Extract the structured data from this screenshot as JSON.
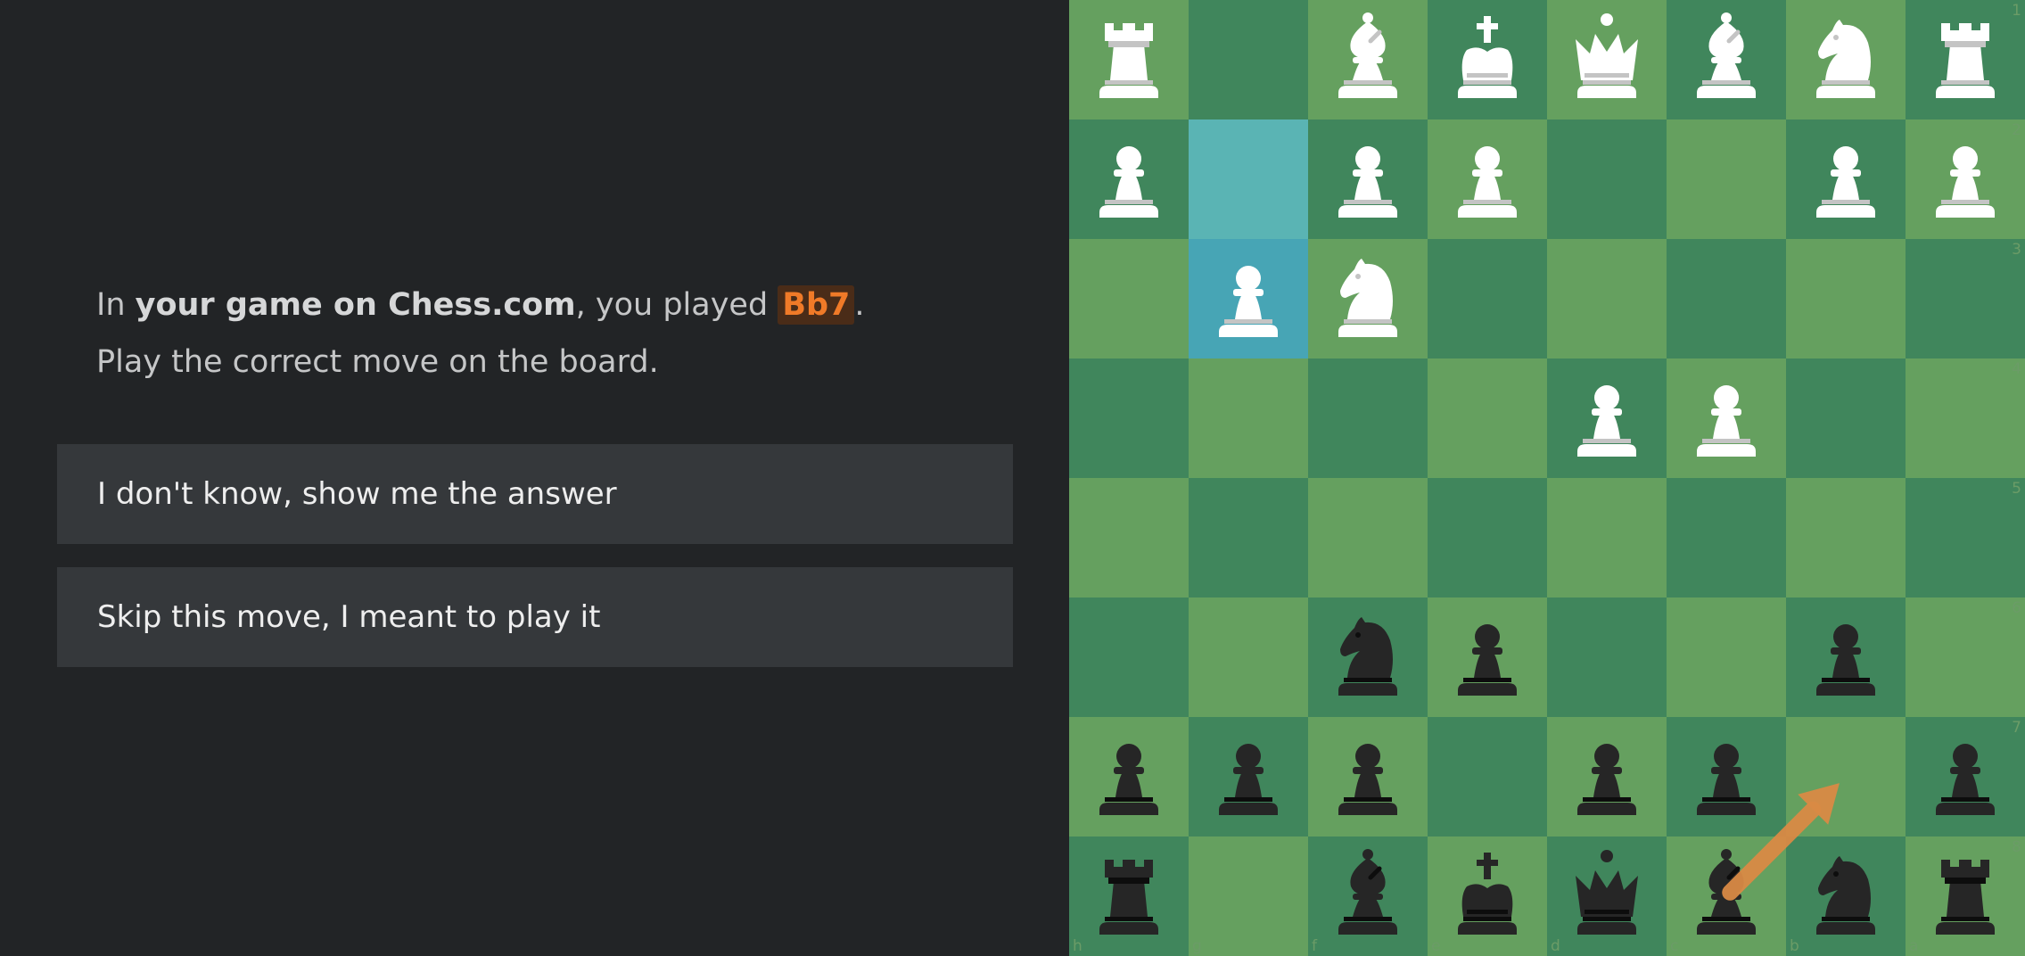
{
  "prompt": {
    "line1_prefix": "In ",
    "line1_strong": "your game on Chess.com",
    "line1_mid": ", you played ",
    "line1_move": "Bb7",
    "line1_suffix": ".",
    "line2": "Play the correct move on the board."
  },
  "buttons": {
    "show_answer": "I don't know, show me the answer",
    "skip_move": "Skip this move, I meant to play it"
  },
  "colors": {
    "light_square": "#65a05f",
    "dark_square": "#40865c",
    "highlight_from": "#5ab4b4",
    "highlight_to": "#47a5b5",
    "arrow": "#d98a45",
    "move_text": "#f07a28"
  },
  "board": {
    "orientation": "black",
    "files_display": [
      "h",
      "g",
      "f",
      "e",
      "d",
      "c",
      "b",
      "a"
    ],
    "ranks_display": [
      "1",
      "2",
      "3",
      "4",
      "5",
      "6",
      "7",
      "8"
    ],
    "highlight": {
      "from": "g2",
      "to": "g3"
    },
    "arrow": {
      "from": "c8",
      "to": "b7"
    },
    "pieces": [
      {
        "square": "h1",
        "color": "w",
        "type": "rook"
      },
      {
        "square": "f1",
        "color": "w",
        "type": "bishop"
      },
      {
        "square": "e1",
        "color": "w",
        "type": "king"
      },
      {
        "square": "d1",
        "color": "w",
        "type": "queen"
      },
      {
        "square": "c1",
        "color": "w",
        "type": "bishop"
      },
      {
        "square": "b1",
        "color": "w",
        "type": "knight"
      },
      {
        "square": "a1",
        "color": "w",
        "type": "rook"
      },
      {
        "square": "h2",
        "color": "w",
        "type": "pawn"
      },
      {
        "square": "f2",
        "color": "w",
        "type": "pawn"
      },
      {
        "square": "e2",
        "color": "w",
        "type": "pawn"
      },
      {
        "square": "b2",
        "color": "w",
        "type": "pawn"
      },
      {
        "square": "a2",
        "color": "w",
        "type": "pawn"
      },
      {
        "square": "g3",
        "color": "w",
        "type": "pawn"
      },
      {
        "square": "f3",
        "color": "w",
        "type": "knight"
      },
      {
        "square": "d4",
        "color": "w",
        "type": "pawn"
      },
      {
        "square": "c4",
        "color": "w",
        "type": "pawn"
      },
      {
        "square": "f6",
        "color": "b",
        "type": "knight"
      },
      {
        "square": "e6",
        "color": "b",
        "type": "pawn"
      },
      {
        "square": "b6",
        "color": "b",
        "type": "pawn"
      },
      {
        "square": "h7",
        "color": "b",
        "type": "pawn"
      },
      {
        "square": "g7",
        "color": "b",
        "type": "pawn"
      },
      {
        "square": "f7",
        "color": "b",
        "type": "pawn"
      },
      {
        "square": "d7",
        "color": "b",
        "type": "pawn"
      },
      {
        "square": "c7",
        "color": "b",
        "type": "pawn"
      },
      {
        "square": "a7",
        "color": "b",
        "type": "pawn"
      },
      {
        "square": "h8",
        "color": "b",
        "type": "rook"
      },
      {
        "square": "f8",
        "color": "b",
        "type": "bishop"
      },
      {
        "square": "e8",
        "color": "b",
        "type": "king"
      },
      {
        "square": "d8",
        "color": "b",
        "type": "queen"
      },
      {
        "square": "c8",
        "color": "b",
        "type": "bishop"
      },
      {
        "square": "b8",
        "color": "b",
        "type": "knight"
      },
      {
        "square": "a8",
        "color": "b",
        "type": "rook"
      }
    ]
  }
}
